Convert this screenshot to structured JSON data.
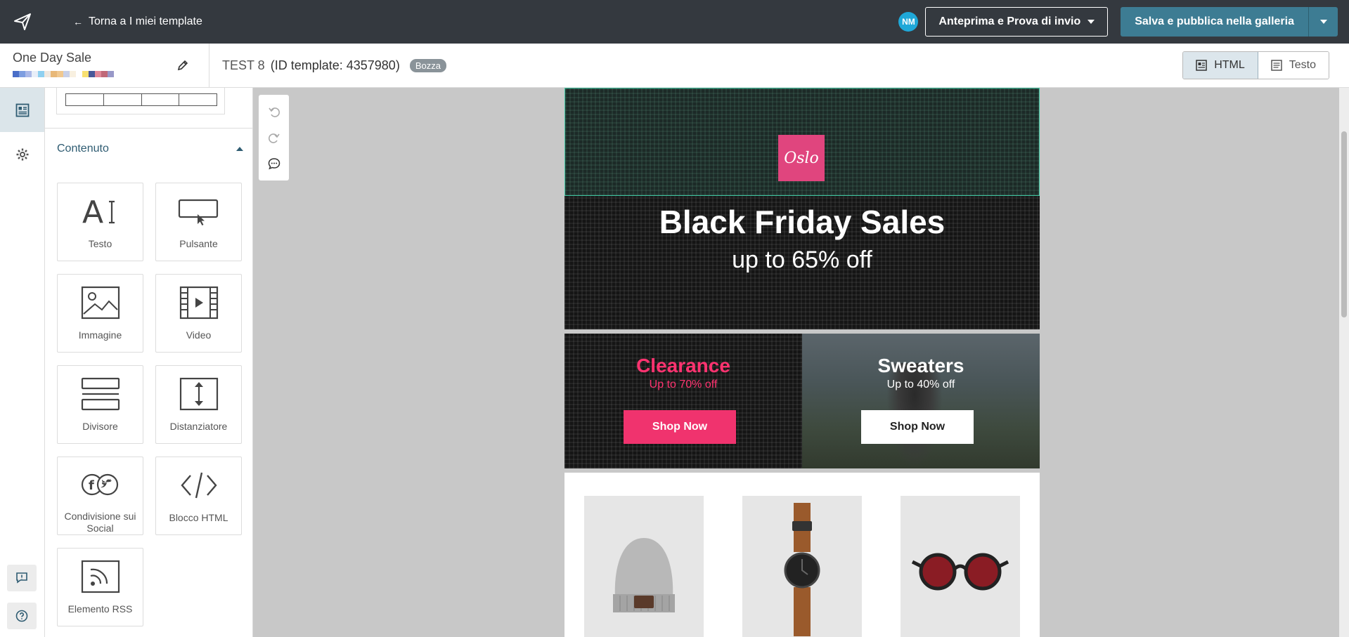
{
  "topbar": {
    "back_label": "Torna a I miei template",
    "avatar_initials": "NM",
    "preview_label": "Anteprima e Prova di invio",
    "publish_label": "Salva e pubblica nella galleria"
  },
  "template": {
    "name": "One Day Sale",
    "title": "TEST 8",
    "id_label": "(ID template: 4357980)",
    "status": "Bozza",
    "swatch_colors": [
      "#4a6ec8",
      "#7d9de0",
      "#aab8e8",
      "#e8eef8",
      "#8fd0f0",
      "#f0e8e0",
      "#e8b878",
      "#f0c890",
      "#c8d0e8",
      "#f8f0e0",
      "#ffffff",
      "#f8e070",
      "#485898",
      "#e08898",
      "#c06878",
      "#9898c8"
    ]
  },
  "mode_toggle": {
    "html_label": "HTML",
    "text_label": "Testo"
  },
  "panel": {
    "section_title": "Contenuto",
    "tiles": [
      {
        "label": "Testo",
        "icon": "text-icon"
      },
      {
        "label": "Pulsante",
        "icon": "button-icon"
      },
      {
        "label": "Immagine",
        "icon": "image-icon"
      },
      {
        "label": "Video",
        "icon": "video-icon"
      },
      {
        "label": "Divisore",
        "icon": "divider-icon"
      },
      {
        "label": "Distanziatore",
        "icon": "spacer-icon"
      },
      {
        "label": "Condivisione sui Social",
        "icon": "social-icon"
      },
      {
        "label": "Blocco HTML",
        "icon": "html-block-icon"
      },
      {
        "label": "Elemento RSS",
        "icon": "rss-icon"
      }
    ]
  },
  "email": {
    "logo_text": "Oslo",
    "hero_title": "Black Friday Sales",
    "hero_subtitle": "up to 65% off",
    "promo_left": {
      "title": "Clearance",
      "subtitle": "Up to 70% off",
      "button": "Shop Now"
    },
    "promo_right": {
      "title": "Sweaters",
      "subtitle": "Up to 40% off",
      "button": "Shop Now"
    },
    "products": [
      "beanie",
      "watch",
      "sunglasses"
    ]
  },
  "colors": {
    "topbar": "#34393f",
    "accent": "#3d7c93",
    "pink": "#f0336e",
    "logo_pink": "#e0457e"
  }
}
